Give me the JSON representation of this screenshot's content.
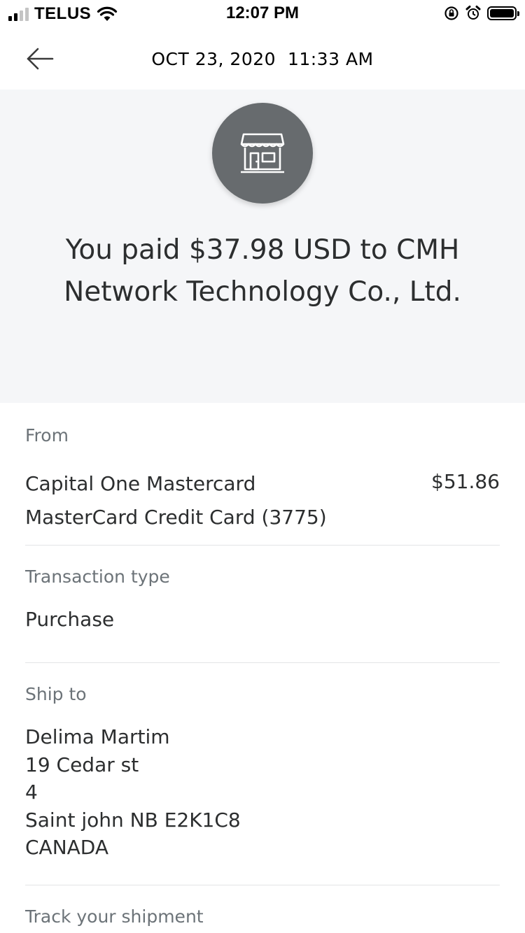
{
  "status_bar": {
    "carrier": "TELUS",
    "time": "12:07 PM",
    "signal_bars_active": 2,
    "signal_bars_total": 4
  },
  "header": {
    "date_time": "OCT 23, 2020  11:33 AM",
    "back_icon": "arrow-left-icon"
  },
  "summary": {
    "merchant_icon": "storefront-icon",
    "text": "You paid $37.98 USD to CMH Network Technology Co., Ltd."
  },
  "from": {
    "label": "From",
    "card_name": "Capital One Mastercard",
    "card_detail": "MasterCard Credit Card (3775)",
    "amount": "$51.86"
  },
  "transaction_type": {
    "label": "Transaction type",
    "value": "Purchase"
  },
  "ship_to": {
    "label": "Ship to",
    "lines": [
      "Delima Martim",
      "19 Cedar st",
      "4",
      "Saint john NB E2K1C8",
      "CANADA"
    ]
  },
  "track": {
    "label": "Track your shipment"
  },
  "colors": {
    "hero_bg": "#f5f6f8",
    "logo_bg": "#676b6e",
    "label_text": "#6c7378",
    "body_text": "#2c2e2f"
  }
}
